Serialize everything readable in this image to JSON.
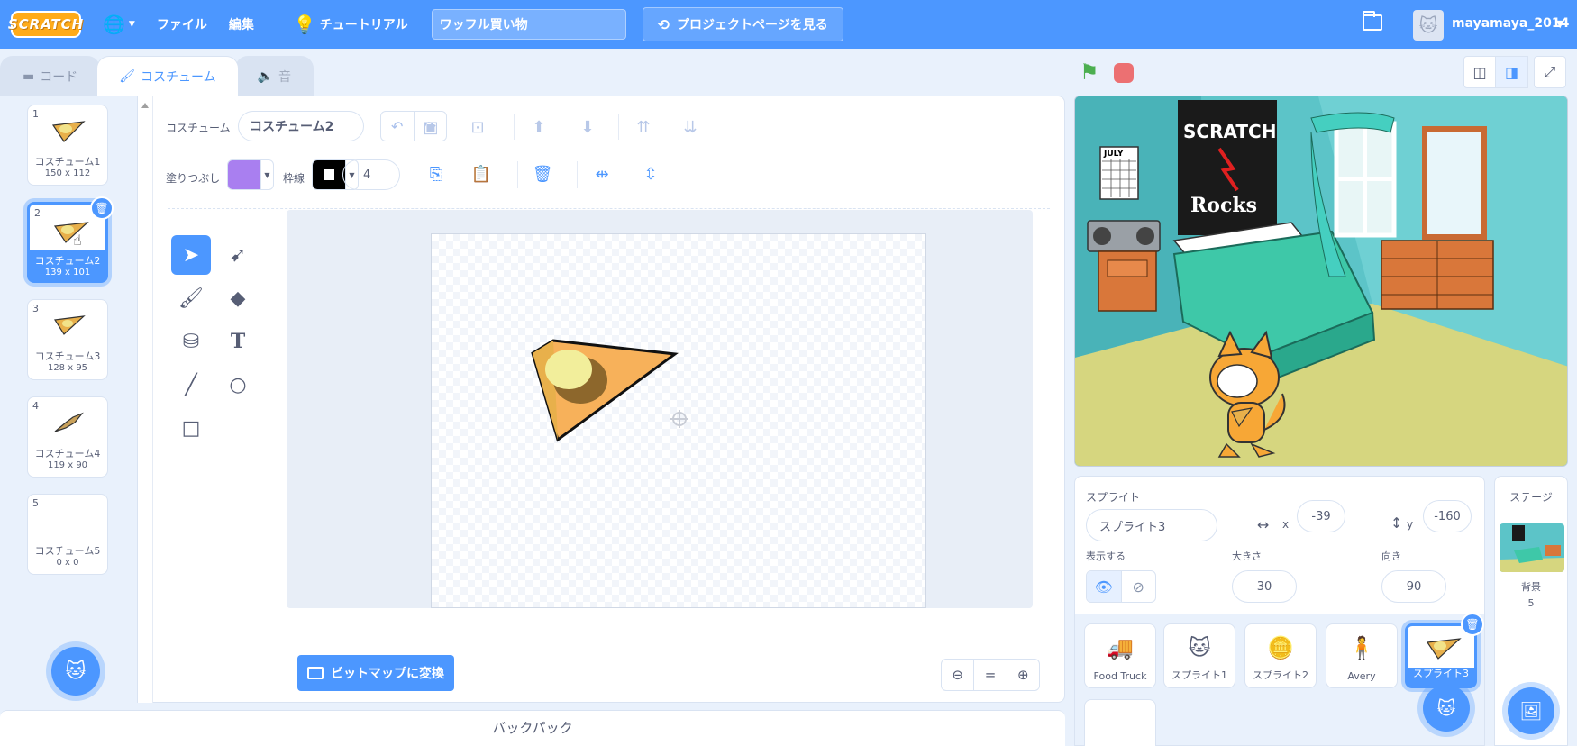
{
  "menubar": {
    "logo": "SCRATCH",
    "file": "ファイル",
    "edit": "編集",
    "tutorial": "チュートリアル",
    "project_title": "ワッフル買い物",
    "see_project_page": "プロジェクトページを見る",
    "username": "mayamaya_2014",
    "language_icon": "globe-icon",
    "folder_icon": "folder-icon"
  },
  "tabs": [
    {
      "label": "コード",
      "icon": "code-icon"
    },
    {
      "label": "コスチューム",
      "icon": "brush-icon"
    },
    {
      "label": "音",
      "icon": "speaker-icon"
    }
  ],
  "costumes": [
    {
      "num": "1",
      "name": "コスチューム1",
      "size": "150 x 112"
    },
    {
      "num": "2",
      "name": "コスチューム2",
      "size": "139 x 101"
    },
    {
      "num": "3",
      "name": "コスチューム3",
      "size": "128 x 95"
    },
    {
      "num": "4",
      "name": "コスチューム4",
      "size": "119 x 90"
    },
    {
      "num": "5",
      "name": "コスチューム5",
      "size": "0 x 0"
    }
  ],
  "selected_costume_index": 1,
  "editor": {
    "costume_label": "コスチューム",
    "costume_name": "コスチューム2",
    "fill_label": "塗りつぶし",
    "fill_color": "#a97ff0",
    "outline_label": "枠線",
    "outline_color": "#000000",
    "outline_width": "4",
    "convert_button": "ビットマップに変換"
  },
  "backpack": "バックパック",
  "sprite_info": {
    "sprite_label": "スプライト",
    "sprite_name": "スプライト3",
    "x_label": "x",
    "x_value": "-39",
    "y_label": "y",
    "y_value": "-160",
    "show_label": "表示する",
    "size_label": "大きさ",
    "size_value": "30",
    "direction_label": "向き",
    "direction_value": "90"
  },
  "sprites": [
    {
      "name": "Food Truck",
      "icon": "food-truck-icon"
    },
    {
      "name": "スプライト1",
      "icon": "cat-icon"
    },
    {
      "name": "スプライト2",
      "icon": "coin-icon"
    },
    {
      "name": "Avery",
      "icon": "person-icon"
    },
    {
      "name": "スプライト3",
      "icon": "waffle-icon"
    }
  ],
  "stage_pane": {
    "title": "ステージ",
    "backdrop_label": "背景",
    "backdrop_count": "5"
  },
  "stage_text": {
    "poster_line1": "SCRATCH",
    "poster_line2": "Rocks",
    "calendar": "JULY"
  },
  "colors": {
    "accent": "#4c97ff",
    "tool_purple": "#855cd6",
    "flag_green": "#4caf50",
    "stop_red": "#ec5959"
  }
}
